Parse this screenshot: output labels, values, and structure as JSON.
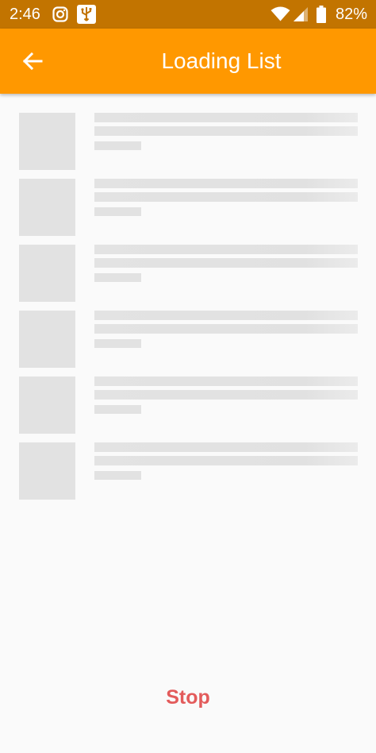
{
  "status_bar": {
    "time": "2:46",
    "battery_percent": "82%",
    "icons": [
      "instagram-icon",
      "usb-icon",
      "wifi-icon",
      "cellular-signal-icon",
      "battery-icon"
    ]
  },
  "app_bar": {
    "title": "Loading List",
    "back_icon": "arrow-left-icon"
  },
  "list": {
    "state": "loading",
    "placeholder_items": 6
  },
  "actions": {
    "stop_label": "Stop"
  },
  "colors": {
    "status_bar": "#c27400",
    "app_bar": "#ff9800",
    "background": "#fafafa",
    "skeleton": "#e2e2e2",
    "stop_text": "#e35b5b"
  }
}
